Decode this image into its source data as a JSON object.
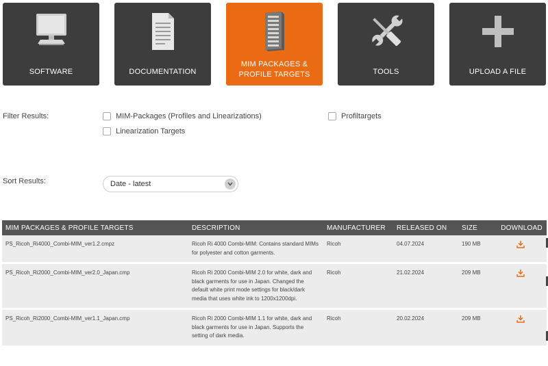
{
  "tiles": [
    {
      "label": "SOFTWARE",
      "icon": "monitor-icon",
      "active": false
    },
    {
      "label": "DOCUMENTATION",
      "icon": "document-icon",
      "active": false
    },
    {
      "label": "MIM PACKAGES &\nPROFILE TARGETS",
      "icon": "server-icon",
      "active": true
    },
    {
      "label": "TOOLS",
      "icon": "wrench-screwdriver-icon",
      "active": false
    },
    {
      "label": "UPLOAD A FILE",
      "icon": "plus-icon",
      "active": false
    }
  ],
  "filter": {
    "label": "Filter Results:",
    "options": [
      "MIM-Packages (Profiles and Linearizations)",
      "Linearization Targets",
      "Profiltargets"
    ]
  },
  "sort": {
    "label": "Sort Results:",
    "value": "Date - latest"
  },
  "table": {
    "headers": [
      "MIM PACKAGES & PROFILE TARGETS",
      "DESCRIPTION",
      "MANUFACTURER",
      "RELEASED ON",
      "SIZE",
      "DOWNLOAD"
    ],
    "rows": [
      {
        "name": "PS_Ricoh_Ri4000_Combi-MIM_ver1.2.cmpz",
        "description": "Ricoh Ri 4000 Combi-MIM: Contains standard MIMs for polyester and cotton garments.",
        "manufacturer": "Ricoh",
        "released": "04.07.2024",
        "size": "190 MB"
      },
      {
        "name": "PS_Ricoh_Ri2000_Combi-MIM_ver2.0_Japan.cmp",
        "description": "Ricoh Ri 2000 Combi-MIM 2.0 for white, dark and black garments for use in Japan. Changed the default white print mode settings for black/dark media that uses white ink to 1200x1200dpi.",
        "manufacturer": "Ricoh",
        "released": "21.02.2024",
        "size": "209 MB"
      },
      {
        "name": "PS_Ricoh_Ri2000_Combi-MIM_ver1.1_Japan.cmp",
        "description": "Ricoh Ri 2000 Combi-MIM 1.1 for white, dark and black garments for use in Japan. Supports the setting of dark media.",
        "manufacturer": "Ricoh",
        "released": "20.02.2024",
        "size": "209 MB"
      }
    ]
  },
  "colors": {
    "tile": "#3d3d3d",
    "accent": "#ea6b14",
    "header": "#555555",
    "row": "#ececec"
  }
}
